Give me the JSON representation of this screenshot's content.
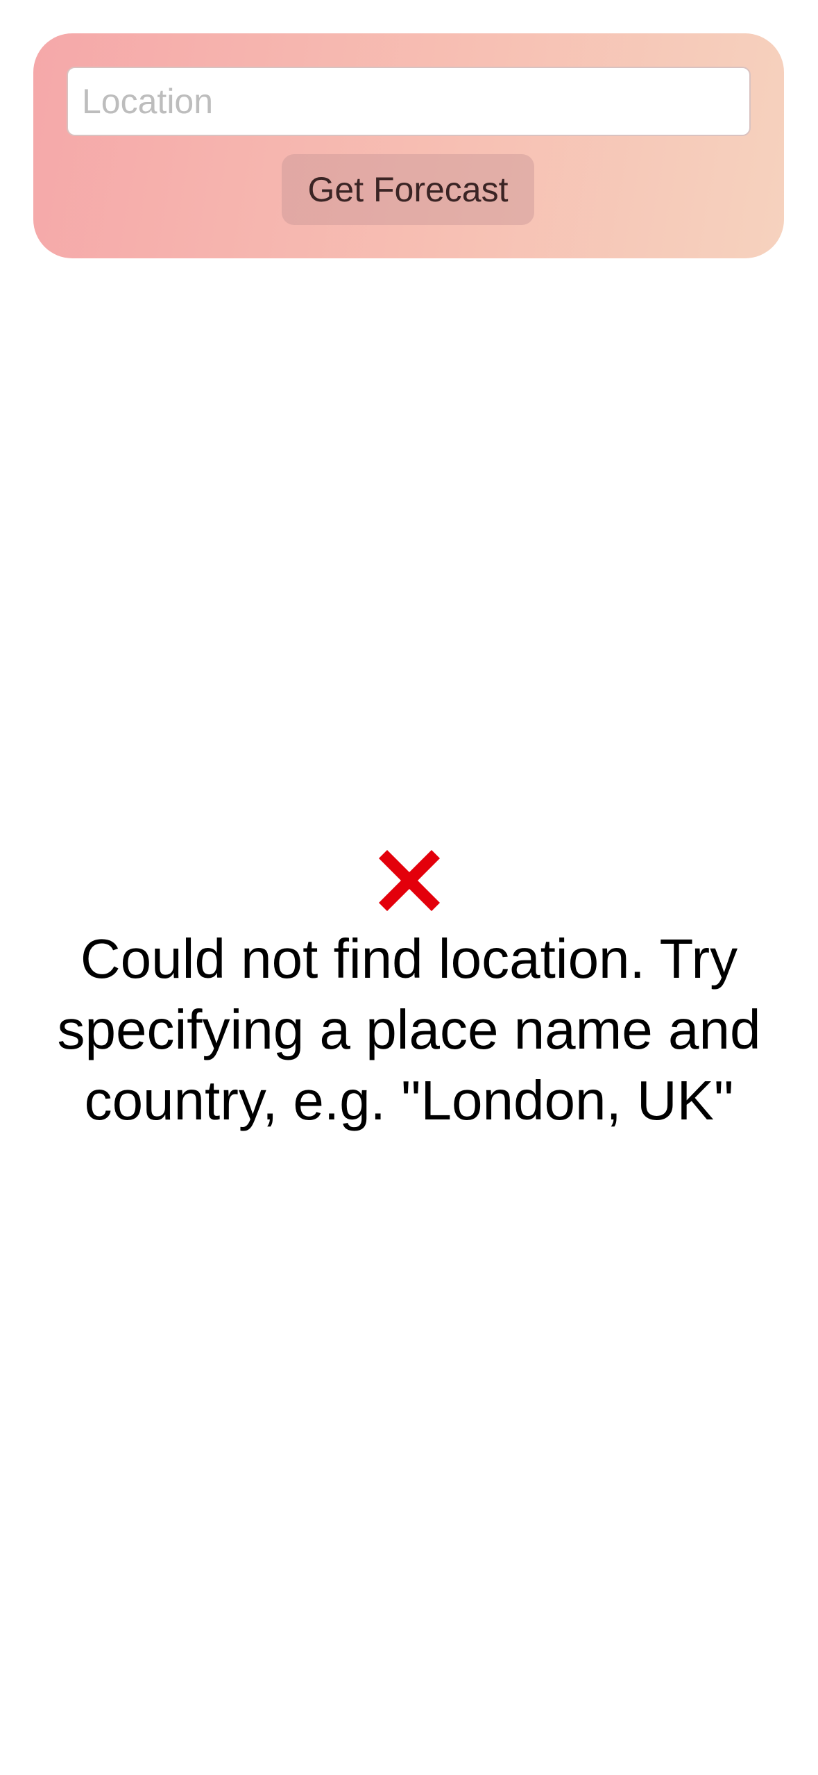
{
  "search": {
    "placeholder": "Location",
    "value": "",
    "button_label": "Get Forecast"
  },
  "error": {
    "icon": "cross-mark-icon",
    "message": "Could not find location. Try specifying a place name and country, e.g. \"London, UK\""
  },
  "colors": {
    "card_gradient_start": "#f5a8a9",
    "card_gradient_end": "#f6d2be",
    "error_icon": "#e3000b"
  }
}
